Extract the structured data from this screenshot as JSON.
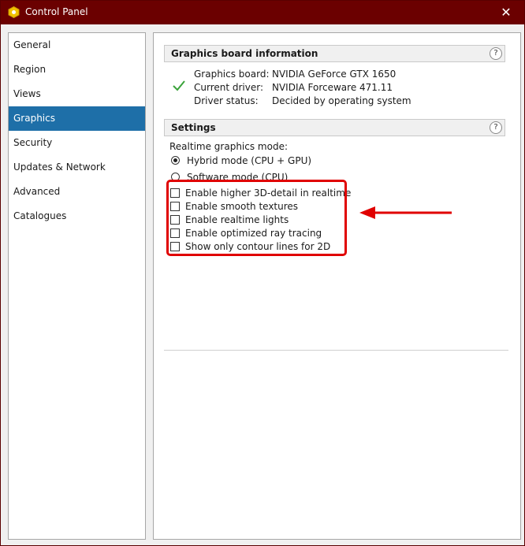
{
  "window": {
    "title": "Control Panel",
    "close_glyph": "✕"
  },
  "sidebar": {
    "items": [
      {
        "label": "General"
      },
      {
        "label": "Region"
      },
      {
        "label": "Views"
      },
      {
        "label": "Graphics",
        "active": true
      },
      {
        "label": "Security"
      },
      {
        "label": "Updates & Network"
      },
      {
        "label": "Advanced"
      },
      {
        "label": "Catalogues"
      }
    ]
  },
  "graphics_board": {
    "title": "Graphics board information",
    "help": "?",
    "rows": [
      {
        "label": "Graphics board:",
        "value": "NVIDIA GeForce GTX 1650"
      },
      {
        "label": "Current driver:",
        "value": "NVIDIA Forceware 471.11"
      },
      {
        "label": "Driver status:",
        "value": "Decided by operating system"
      }
    ]
  },
  "settings": {
    "title": "Settings",
    "help": "?",
    "mode_label": "Realtime graphics mode:",
    "modes": [
      {
        "label": "Hybrid mode (CPU + GPU)",
        "checked": true
      },
      {
        "label": "Software mode (CPU)",
        "checked": false
      }
    ],
    "options": [
      {
        "label": "Enable higher 3D-detail in realtime",
        "checked": false
      },
      {
        "label": "Enable smooth textures",
        "checked": false
      },
      {
        "label": "Enable realtime lights",
        "checked": false
      },
      {
        "label": "Enable optimized ray tracing",
        "checked": false
      },
      {
        "label": "Show only contour lines for 2D",
        "checked": false
      }
    ]
  },
  "colors": {
    "titlebar": "#6b0000",
    "selection": "#1e6fa8",
    "annotation": "#e00000",
    "status_ok": "#3aa33a"
  }
}
